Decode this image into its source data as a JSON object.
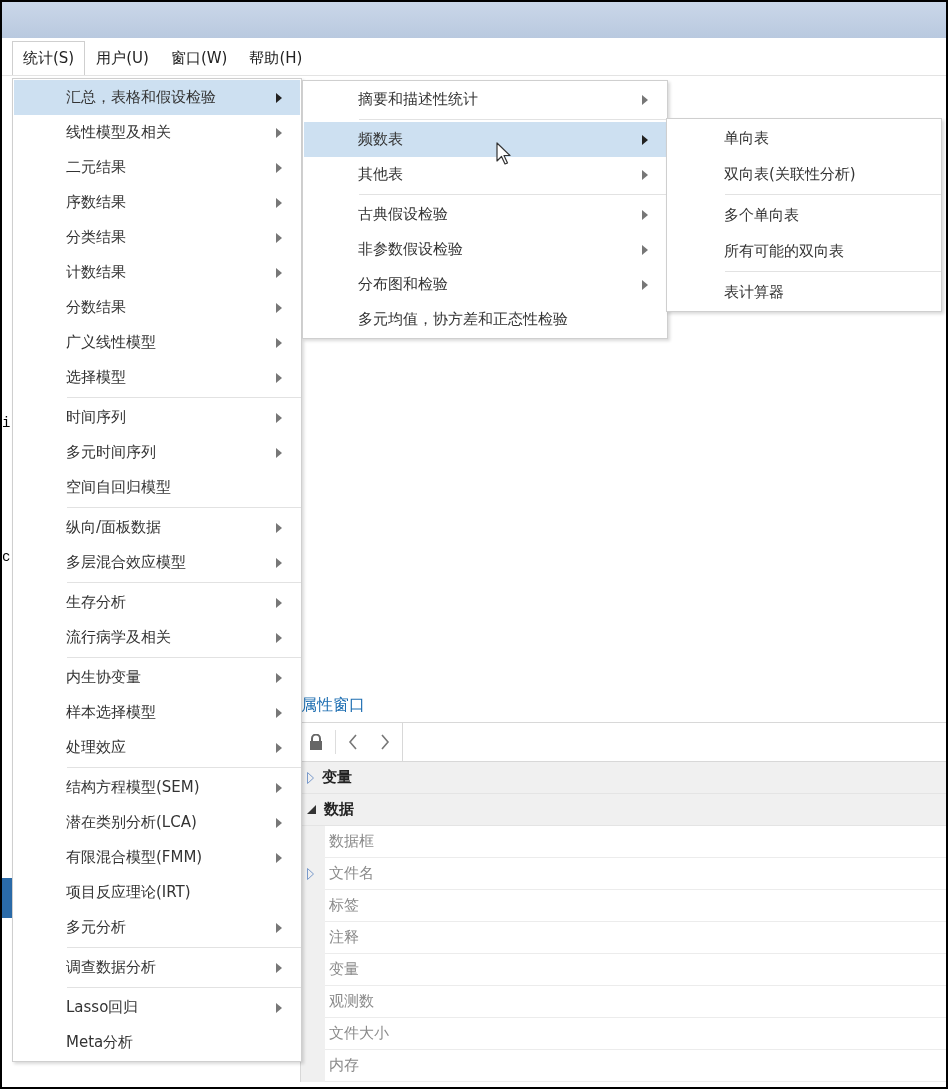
{
  "menubar": [
    {
      "label": "统计(S)",
      "selected": true
    },
    {
      "label": "用户(U)",
      "selected": false
    },
    {
      "label": "窗口(W)",
      "selected": false
    },
    {
      "label": "帮助(H)",
      "selected": false
    }
  ],
  "background_fragments": [
    "i",
    "c"
  ],
  "main_menu": {
    "groups": [
      [
        {
          "label": "汇总，表格和假设检验",
          "submenu": true,
          "selected": true
        },
        {
          "label": "线性模型及相关",
          "submenu": true,
          "selected": false
        },
        {
          "label": "二元结果",
          "submenu": true,
          "selected": false
        },
        {
          "label": "序数结果",
          "submenu": true,
          "selected": false
        },
        {
          "label": "分类结果",
          "submenu": true,
          "selected": false
        },
        {
          "label": "计数结果",
          "submenu": true,
          "selected": false
        },
        {
          "label": "分数结果",
          "submenu": true,
          "selected": false
        },
        {
          "label": "广义线性模型",
          "submenu": true,
          "selected": false
        },
        {
          "label": "选择模型",
          "submenu": true,
          "selected": false
        }
      ],
      [
        {
          "label": "时间序列",
          "submenu": true,
          "selected": false
        },
        {
          "label": "多元时间序列",
          "submenu": true,
          "selected": false
        },
        {
          "label": "空间自回归模型",
          "submenu": false,
          "selected": false
        }
      ],
      [
        {
          "label": "纵向/面板数据",
          "submenu": true,
          "selected": false
        },
        {
          "label": "多层混合效应模型",
          "submenu": true,
          "selected": false
        }
      ],
      [
        {
          "label": "生存分析",
          "submenu": true,
          "selected": false
        },
        {
          "label": "流行病学及相关",
          "submenu": true,
          "selected": false
        }
      ],
      [
        {
          "label": "内生协变量",
          "submenu": true,
          "selected": false
        },
        {
          "label": "样本选择模型",
          "submenu": true,
          "selected": false
        },
        {
          "label": "处理效应",
          "submenu": true,
          "selected": false
        }
      ],
      [
        {
          "label": "结构方程模型(SEM)",
          "submenu": true,
          "selected": false
        },
        {
          "label": "潜在类别分析(LCA)",
          "submenu": true,
          "selected": false
        },
        {
          "label": "有限混合模型(FMM)",
          "submenu": true,
          "selected": false
        },
        {
          "label": "项目反应理论(IRT)",
          "submenu": false,
          "selected": false
        },
        {
          "label": "多元分析",
          "submenu": true,
          "selected": false
        }
      ],
      [
        {
          "label": "调查数据分析",
          "submenu": true,
          "selected": false
        }
      ],
      [
        {
          "label": "Lasso回归",
          "submenu": true,
          "selected": false
        },
        {
          "label": "Meta分析",
          "submenu": false,
          "selected": false
        }
      ]
    ]
  },
  "submenu_1": {
    "groups": [
      [
        {
          "label": "摘要和描述性统计",
          "submenu": true,
          "selected": false
        }
      ],
      [
        {
          "label": "频数表",
          "submenu": true,
          "selected": true
        },
        {
          "label": "其他表",
          "submenu": true,
          "selected": false
        }
      ],
      [
        {
          "label": "古典假设检验",
          "submenu": true,
          "selected": false
        },
        {
          "label": "非参数假设检验",
          "submenu": true,
          "selected": false
        },
        {
          "label": "分布图和检验",
          "submenu": true,
          "selected": false
        },
        {
          "label": "多元均值，协方差和正态性检验",
          "submenu": false,
          "selected": false
        }
      ]
    ]
  },
  "submenu_2": {
    "groups": [
      [
        {
          "label": "单向表",
          "submenu": false,
          "selected": false
        },
        {
          "label": "双向表(关联性分析)",
          "submenu": false,
          "selected": false
        }
      ],
      [
        {
          "label": "多个单向表",
          "submenu": false,
          "selected": false
        },
        {
          "label": "所有可能的双向表",
          "submenu": false,
          "selected": false
        }
      ],
      [
        {
          "label": "表计算器",
          "submenu": false,
          "selected": false
        }
      ]
    ]
  },
  "properties": {
    "title": "属性窗口",
    "tree": [
      {
        "label": "变量",
        "expanded": false
      },
      {
        "label": "数据",
        "expanded": true,
        "children": [
          {
            "label": "数据框",
            "expandable": false
          },
          {
            "label": "文件名",
            "expandable": true
          },
          {
            "label": "标签",
            "expandable": false
          },
          {
            "label": "注释",
            "expandable": false
          },
          {
            "label": "变量",
            "expandable": false
          },
          {
            "label": "观测数",
            "expandable": false
          },
          {
            "label": "文件大小",
            "expandable": false
          },
          {
            "label": "内存",
            "expandable": false
          }
        ]
      }
    ]
  }
}
